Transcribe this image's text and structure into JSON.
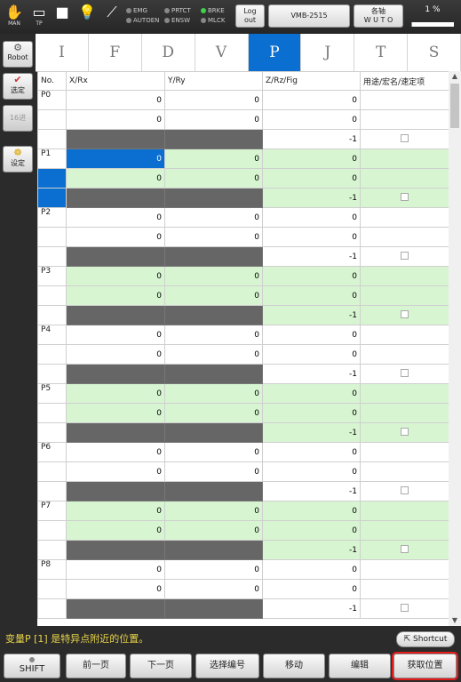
{
  "topbar": {
    "icons": [
      {
        "name": "man-hand-icon",
        "glyph": "✋",
        "label": "MAN"
      },
      {
        "name": "teach-pendant-icon",
        "glyph": "▭",
        "label": "TP"
      },
      {
        "name": "stop-square-icon",
        "glyph": "■",
        "label": ""
      },
      {
        "name": "lightbulb-icon",
        "glyph": "💡",
        "label": ""
      },
      {
        "name": "wrench-icon",
        "glyph": "⟋",
        "label": ""
      }
    ],
    "status": [
      {
        "label": "EMG",
        "on": false
      },
      {
        "label": "AUTOEN",
        "on": false
      },
      {
        "label": "PRTCT",
        "on": false
      },
      {
        "label": "ENSW",
        "on": false
      },
      {
        "label": "BRKE",
        "on": true
      },
      {
        "label": "MLCK",
        "on": false
      }
    ],
    "logout_label": "Log\nout",
    "robot_name": "VMB-2515",
    "axis_label": "各轴\nW U T O",
    "speed": "1 %",
    "speed_fraction": 0.01
  },
  "side": {
    "robot": "Robot",
    "select": "选定",
    "hex": "16进",
    "settings": "设定"
  },
  "tabs": [
    "I",
    "F",
    "D",
    "V",
    "P",
    "J",
    "T",
    "S"
  ],
  "active_tab": "P",
  "table": {
    "headers": [
      "No.",
      "X/Rx",
      "Y/Ry",
      "Z/Rz/Fig",
      "用途/宏名/速定项"
    ],
    "rows": [
      {
        "name": "P0",
        "x": "0",
        "y": "0",
        "z": "0",
        "rx": "0",
        "ry": "0",
        "rz": "0",
        "fig": "-1",
        "green": false
      },
      {
        "name": "P1",
        "x": "0",
        "y": "0",
        "z": "0",
        "rx": "0",
        "ry": "0",
        "rz": "0",
        "fig": "-1",
        "green": true
      },
      {
        "name": "P2",
        "x": "0",
        "y": "0",
        "z": "0",
        "rx": "0",
        "ry": "0",
        "rz": "0",
        "fig": "-1",
        "green": false
      },
      {
        "name": "P3",
        "x": "0",
        "y": "0",
        "z": "0",
        "rx": "0",
        "ry": "0",
        "rz": "0",
        "fig": "-1",
        "green": true
      },
      {
        "name": "P4",
        "x": "0",
        "y": "0",
        "z": "0",
        "rx": "0",
        "ry": "0",
        "rz": "0",
        "fig": "-1",
        "green": false
      },
      {
        "name": "P5",
        "x": "0",
        "y": "0",
        "z": "0",
        "rx": "0",
        "ry": "0",
        "rz": "0",
        "fig": "-1",
        "green": true
      },
      {
        "name": "P6",
        "x": "0",
        "y": "0",
        "z": "0",
        "rx": "0",
        "ry": "0",
        "rz": "0",
        "fig": "-1",
        "green": false
      },
      {
        "name": "P7",
        "x": "0",
        "y": "0",
        "z": "0",
        "rx": "0",
        "ry": "0",
        "rz": "0",
        "fig": "-1",
        "green": true
      },
      {
        "name": "P8",
        "x": "0",
        "y": "0",
        "z": "0",
        "rx": "0",
        "ry": "0",
        "rz": "0",
        "fig": "-1",
        "green": false
      }
    ]
  },
  "message": "变量P [1] 是特异点附近的位置。",
  "shortcut": "Shortcut",
  "bottom": {
    "shift": "SHIFT",
    "prev": "前一页",
    "next": "下一页",
    "select_no": "选择编号",
    "move": "移动",
    "edit": "编辑",
    "get_pos": "获取位置"
  }
}
